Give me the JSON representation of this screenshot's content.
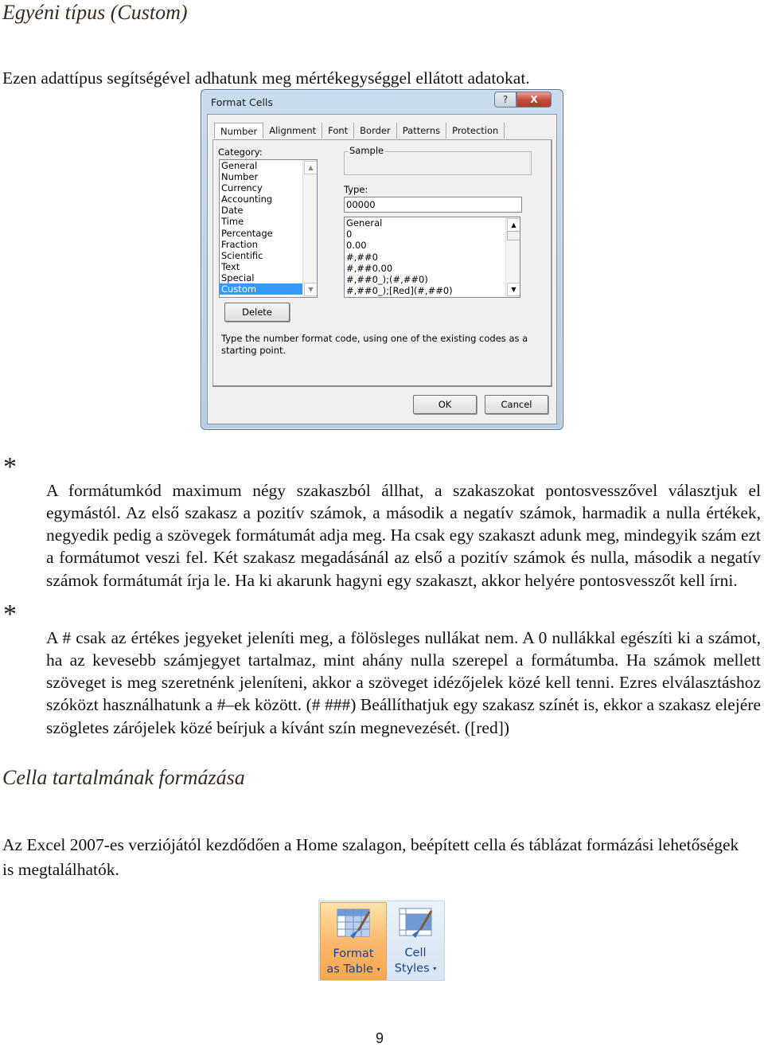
{
  "headings": {
    "custom_type": "Egyéni típus (Custom)",
    "cell_content_format": "Cella tartalmának formázása"
  },
  "intro": "Ezen adattípus segítségével adhatunk meg mértékegységgel ellátott adatokat.",
  "dialog": {
    "title": "Format Cells",
    "help_label": "?",
    "close_label": "X",
    "tabs": [
      "Number",
      "Alignment",
      "Font",
      "Border",
      "Patterns",
      "Protection"
    ],
    "active_tab": "Number",
    "category_label": "Category:",
    "categories": [
      "General",
      "Number",
      "Currency",
      "Accounting",
      "Date",
      "Time",
      "Percentage",
      "Fraction",
      "Scientific",
      "Text",
      "Special",
      "Custom"
    ],
    "selected_category": "Custom",
    "sample_label": "Sample",
    "type_label": "Type:",
    "type_value": "00000",
    "type_options": [
      "General",
      "0",
      "0.00",
      "#,##0",
      "#,##0.00",
      "#,##0_);(#,##0)",
      "#,##0_);[Red](#,##0)"
    ],
    "delete_label": "Delete",
    "hint": "Type the number format code, using one of the existing codes as a starting point.",
    "ok_label": "OK",
    "cancel_label": "Cancel"
  },
  "bullets": {
    "symbol": "*",
    "items": [
      "A formátumkód maximum négy szakaszból állhat, a szakaszokat pontosvesszővel választjuk el egymástól. Az első szakasz a pozitív számok, a második a negatív számok, harmadik a nulla értékek, negyedik pedig a szövegek formátumát adja meg. Ha csak egy szakaszt adunk meg, mindegyik szám ezt a formátumot veszi fel. Két szakasz megadásánál az első a pozitív számok és nulla, második a negatív számok formátumát írja le. Ha ki akarunk hagyni egy szakaszt, akkor helyére pontosvesszőt kell írni.",
      "A # csak az értékes jegyeket jeleníti meg, a fölösleges nullákat nem. A 0 nullákkal egészíti ki a számot, ha az kevesebb számjegyet tartalmaz, mint ahány nulla szerepel a formátumba. Ha számok mellett szöveget is meg szeretnénk jeleníteni, akkor a szöveget idézőjelek közé kell tenni. Ezres elválasztáshoz szóközt használhatunk a #–ek között. (# ###) Beállíthatjuk egy szakasz színét is, ekkor a szakasz elejére szögletes zárójelek közé beírjuk a kívánt szín megnevezését. ([red])"
    ]
  },
  "para2": "Az Excel 2007-es verziójától kezdődően a Home szalagon, beépített cella és táblázat formázási lehetőségek is megtalálhatók.",
  "ribbon": {
    "format_table_line1": "Format",
    "format_table_line2": "as Table",
    "cell_styles_line1": "Cell",
    "cell_styles_line2": "Styles",
    "dropdown_glyph": "▾"
  },
  "page_number": "9"
}
